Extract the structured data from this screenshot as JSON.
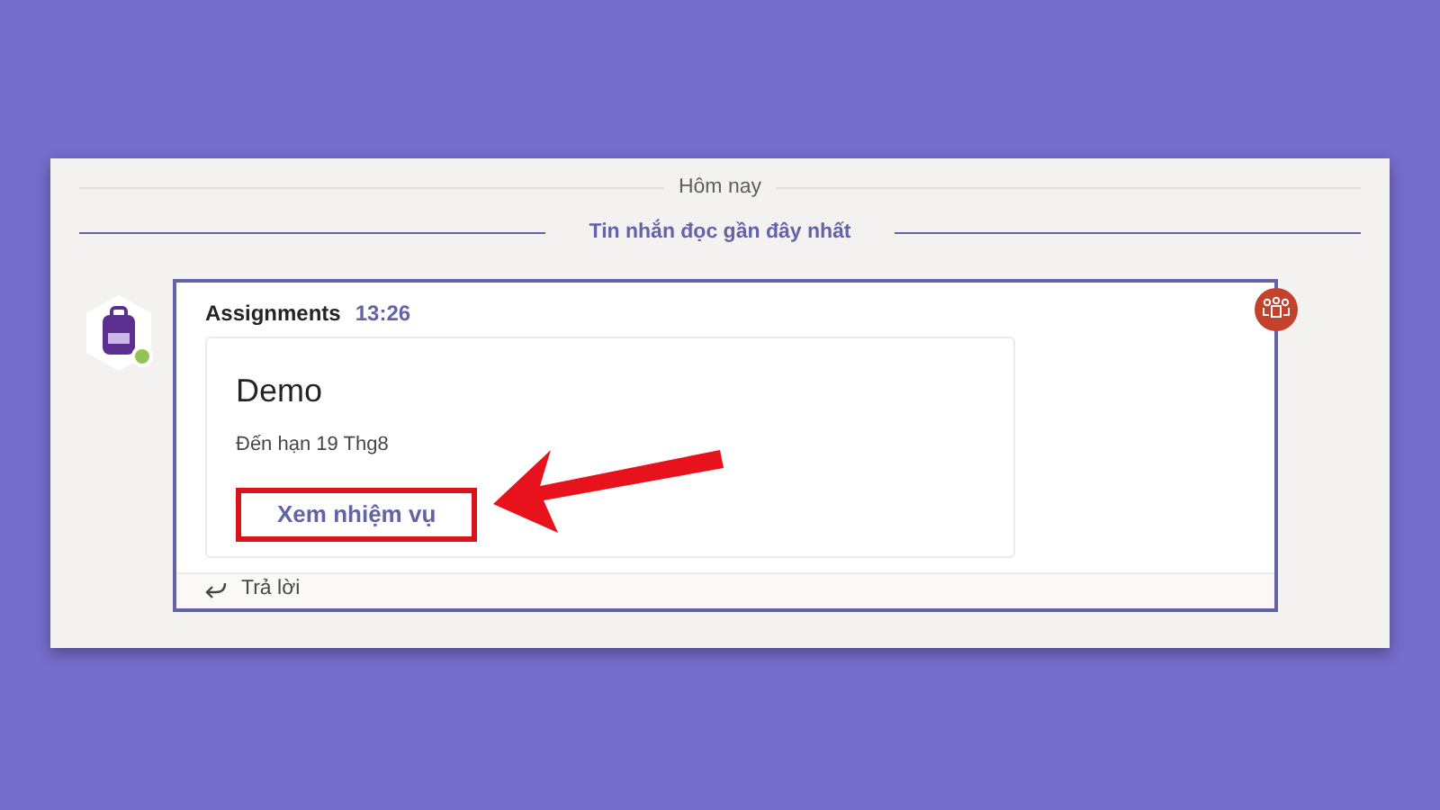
{
  "day_divider": {
    "label": "Hôm nay"
  },
  "unread_divider": {
    "label": "Tin nhắn đọc gần đây nhất"
  },
  "message": {
    "sender": "Assignments",
    "time": "13:26",
    "online": true,
    "highlighted": true,
    "card": {
      "title": "Demo",
      "due": "Đến hạn 19 Thg8",
      "action": {
        "label": "Xem nhiệm vụ",
        "annotated": true
      }
    },
    "reply": {
      "label": "Trả lời"
    }
  }
}
